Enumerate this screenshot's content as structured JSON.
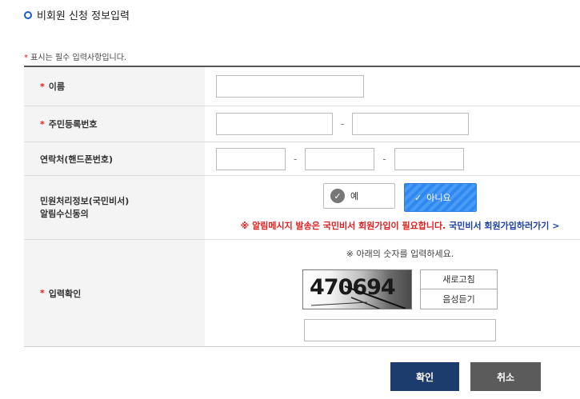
{
  "section": {
    "title": "비회원 신청 정보입력"
  },
  "required_note": {
    "star": "*",
    "text": " 표시는 필수 입력사항입니다."
  },
  "form": {
    "name_label": "이름",
    "rrn_label": "주민등록번호",
    "rrn_dash": "-",
    "phone_label": "연락처(핸드폰번호)",
    "phone_dash": "-",
    "consent_label_line1": "민원처리정보(국민비서)",
    "consent_label_line2": "알림수신동의",
    "consent_yes": "예",
    "consent_no": "아니요",
    "notice_red": "※ 알림메시지 발송은 국민비서 회원가입이 필요합니다.",
    "notice_blue": "국민비서 회원가입하러가기 >",
    "captcha_label": "입력확인",
    "captcha_instruction": "※ 아래의 숫자를 입력하세요.",
    "captcha_value": "470694",
    "refresh_label": "새로고침",
    "audio_label": "음성듣기",
    "star": "*"
  },
  "actions": {
    "confirm": "확인",
    "cancel": "취소"
  },
  "colors": {
    "accent": "#1a5ec4",
    "required": "#e02020",
    "confirm_bg": "#1d3c6e",
    "cancel_bg": "#5b5b5b",
    "selected_bg": "#2f88ef"
  },
  "icons": {
    "section": "ring-bullet-icon",
    "yes": "check-circle-icon",
    "no": "check-mark-icon"
  }
}
